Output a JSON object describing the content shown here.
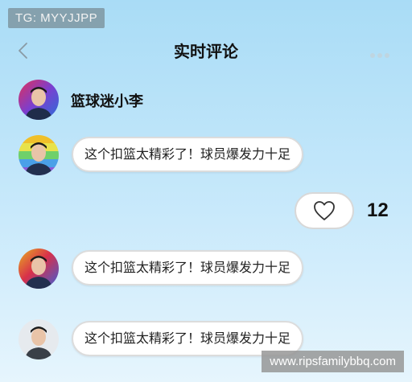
{
  "overlay": {
    "tg_label": "TG: MYYJJPP"
  },
  "header": {
    "title": "实时评论",
    "back_icon": "chevron-left-icon",
    "more_icon": "more-dots-icon"
  },
  "user": {
    "name": "篮球迷小李"
  },
  "comments": [
    {
      "text": "这个扣篮太精彩了！球员爆发力十足",
      "avatar_bg": "rainbow-stripes"
    },
    {
      "text": "这个扣篮太精彩了！球员爆发力十足",
      "avatar_bg": "rainbow-stripes"
    },
    {
      "text": "这个扣篮太精彩了！球员爆发力十足",
      "avatar_bg": "light-gray"
    }
  ],
  "like": {
    "icon": "heart-icon",
    "count": "12"
  },
  "footer": {
    "watermark": "www.ripsfamilybbq.com"
  }
}
